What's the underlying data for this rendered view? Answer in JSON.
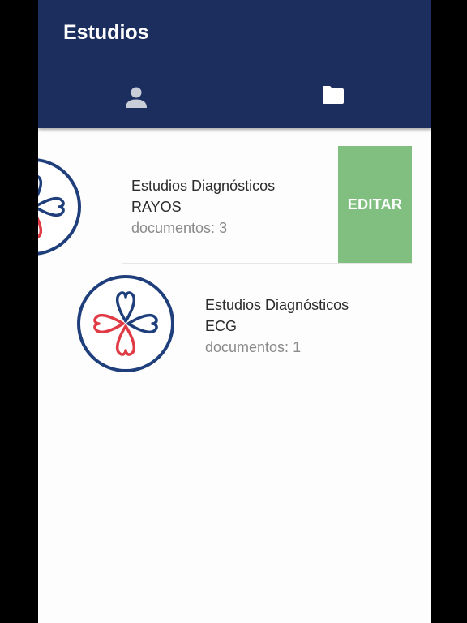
{
  "app": {
    "title": "Estudios",
    "colors": {
      "appbar": "#1b2e5e",
      "edit_action": "#81bf81",
      "logo_blue": "#1e3f7b",
      "logo_red": "#e03a45"
    }
  },
  "tabs": [
    {
      "icon": "person-icon",
      "selected": false
    },
    {
      "icon": "folder-icon",
      "selected": true
    }
  ],
  "items": [
    {
      "title": "Estudios Diagnósticos",
      "subtitle": "RAYOS",
      "docs_label": "documentos:",
      "docs_count": "3",
      "swipe_action": "EDITAR"
    },
    {
      "title": "Estudios Diagnósticos",
      "subtitle": "ECG",
      "docs_label": "documentos:",
      "docs_count": "1"
    }
  ]
}
